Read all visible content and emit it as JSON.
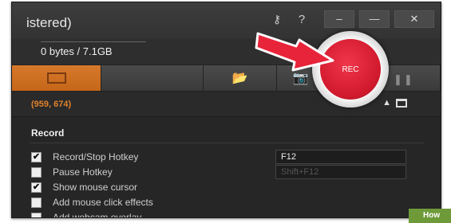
{
  "titlebar": {
    "title": "istered)",
    "key_glyph": "⚷",
    "help_glyph": "?",
    "minimize_glyph": "–",
    "maximize_glyph": "—",
    "close_glyph": "✕"
  },
  "storage": {
    "text": "0 bytes / 7.1GB"
  },
  "toolbar": {
    "folder_glyph": "📂",
    "camera_glyph": "📷",
    "active_color": "#d7792c"
  },
  "coords": {
    "value": "(959, 674)",
    "collapse_glyph": "▲"
  },
  "record": {
    "section_title": "Record",
    "options": [
      {
        "label": "Record/Stop Hotkey",
        "checked": true,
        "field": "F12",
        "field_disabled": false
      },
      {
        "label": "Pause Hotkey",
        "checked": false,
        "field": "Shift+F12",
        "field_disabled": true
      },
      {
        "label": "Show mouse cursor",
        "checked": true
      },
      {
        "label": "Add mouse click effects",
        "checked": false
      },
      {
        "label": "Add webcam overlay",
        "checked": false
      }
    ],
    "check_glyph": "✔"
  },
  "rec_button": {
    "label": "REC",
    "color": "#d21a2e"
  },
  "pause_glyph": "❚❚",
  "watermark": "How"
}
